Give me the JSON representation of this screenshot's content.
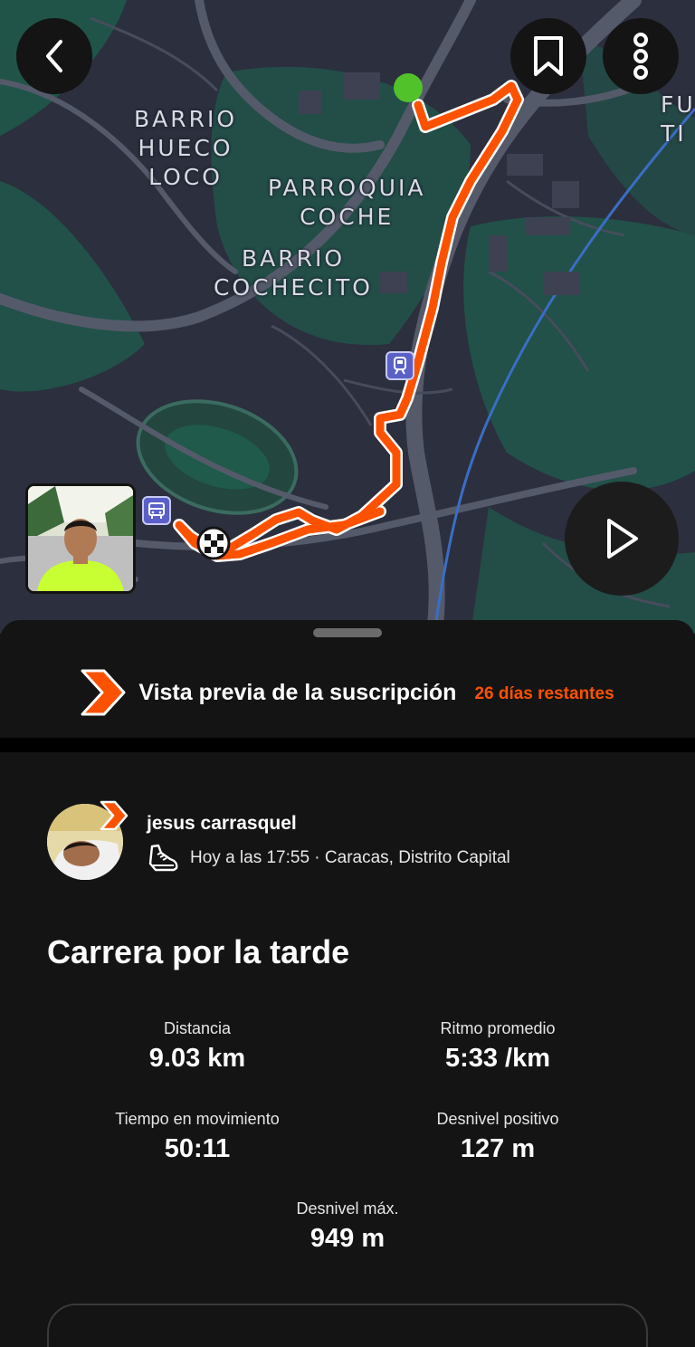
{
  "map": {
    "labels": [
      "BARRIO\nHUECO\nLOCO",
      "PARROQUIA\nCOCHE",
      "BARRIO\nCOCHECITO",
      "FU\nTI"
    ],
    "colors": {
      "route": "#fc5200",
      "start": "#52c22b",
      "land": "#2c2f3d",
      "green": "#1f5a4b",
      "road": "#5a5e6e"
    }
  },
  "header": {
    "back_icon": "chevron-left-icon",
    "save_icon": "bookmark-icon",
    "more_icon": "more-vertical-icon"
  },
  "subscription": {
    "title": "Vista previa de la suscripción",
    "remaining": "26 días restantes"
  },
  "athlete": {
    "name": "jesus carrasquel",
    "meta": "Hoy a las 17:55 · Caracas, Distrito Capital",
    "sport_icon": "running-shoe-icon"
  },
  "activity": {
    "title": "Carrera por la tarde",
    "stats": [
      {
        "label": "Distancia",
        "value": "9.03 km"
      },
      {
        "label": "Ritmo promedio",
        "value": "5:33 /km"
      },
      {
        "label": "Tiempo en movimiento",
        "value": "50:11"
      },
      {
        "label": "Desnivel positivo",
        "value": "127 m"
      },
      {
        "label": "Desnivel máx.",
        "value": "949 m"
      }
    ]
  },
  "accent_color": "#fc5200"
}
